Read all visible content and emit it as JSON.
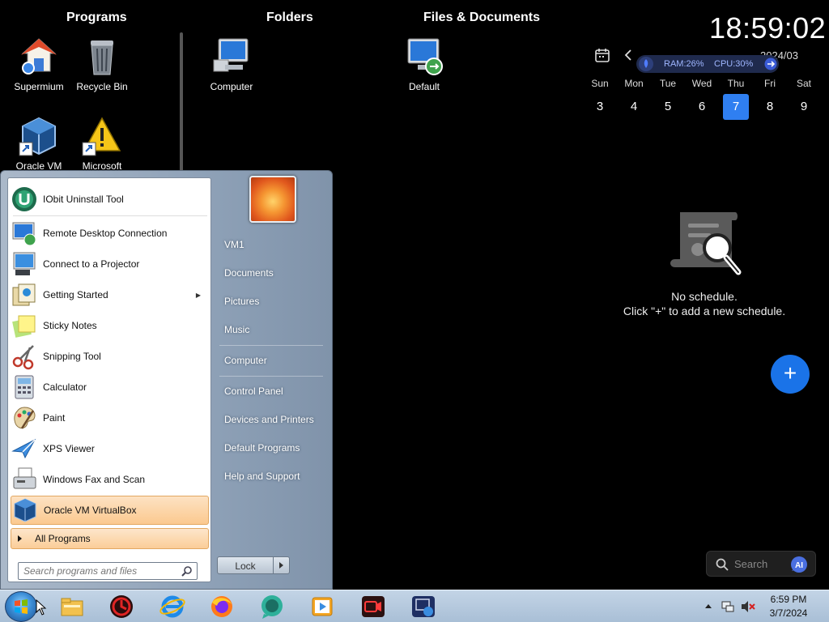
{
  "desktop": {
    "fences": [
      {
        "title": "Programs"
      },
      {
        "title": "Folders"
      },
      {
        "title": "Files & Documents"
      }
    ],
    "icons": {
      "supermium": "Supermium",
      "recycle_bin": "Recycle Bin",
      "computer": "Computer",
      "default": "Default",
      "oracle_vm": "Oracle VM",
      "microsoft": "Microsoft"
    }
  },
  "widget": {
    "clock": "18:59:02",
    "year_month": "2024/03",
    "ram": "RAM:26%",
    "cpu": "CPU:30%",
    "weekdays": [
      "Sun",
      "Mon",
      "Tue",
      "Wed",
      "Thu",
      "Fri",
      "Sat"
    ],
    "days": [
      "3",
      "4",
      "5",
      "6",
      "7",
      "8",
      "9"
    ],
    "today": "7",
    "empty_title": "No schedule.",
    "empty_hint": "Click \"+\" to add a new schedule.",
    "add_label": "+",
    "search_label": "Search",
    "ai_label": "AI"
  },
  "start_menu": {
    "pinned": [
      "IObit Uninstall Tool"
    ],
    "recent": [
      "Remote Desktop Connection",
      "Connect to a Projector",
      "Getting Started",
      "Sticky Notes",
      "Snipping Tool",
      "Calculator",
      "Paint",
      "XPS Viewer",
      "Windows Fax and Scan",
      "Oracle VM VirtualBox"
    ],
    "all_programs": "All Programs",
    "search_placeholder": "Search programs and files",
    "right_items": [
      "VM1",
      "Documents",
      "Pictures",
      "Music",
      "Computer",
      "Control Panel",
      "Devices and Printers",
      "Default Programs",
      "Help and Support"
    ],
    "lock_label": "Lock"
  },
  "taskbar": {
    "time": "6:59 PM",
    "date": "3/7/2024"
  }
}
